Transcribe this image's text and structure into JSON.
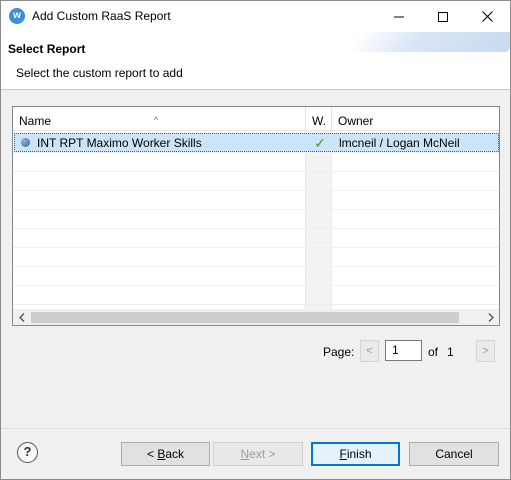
{
  "window": {
    "title": "Add Custom RaaS Report",
    "app_icon_glyph": "w"
  },
  "banner": {
    "title": "Select Report",
    "subtitle": "Select the custom report to add"
  },
  "table": {
    "columns": [
      "Name",
      "W.",
      "Owner"
    ],
    "sort_indicator": "^",
    "rows": [
      {
        "name": "INT RPT Maximo Worker Skills",
        "w_checked": true,
        "check_glyph": "✓",
        "owner": "lmcneil / Logan McNeil",
        "selected": true
      }
    ]
  },
  "pager": {
    "label": "Page:",
    "prev": "<",
    "next": ">",
    "current": "1",
    "of": "of",
    "total": "1"
  },
  "buttons": {
    "back_prefix": "< ",
    "back_mnemonic": "B",
    "back_rest": "ack",
    "next_mnemonic": "N",
    "next_rest": "ext >",
    "finish_mnemonic": "F",
    "finish_rest": "inish",
    "cancel": "Cancel",
    "help": "?"
  },
  "colors": {
    "selection": "#cce4f7",
    "default_button_border": "#0078d7",
    "check": "#3c9a1f"
  },
  "icons": {
    "app": "workday-app-icon",
    "minimize": "minimize-icon",
    "maximize": "maximize-icon",
    "close": "close-icon",
    "row": "report-bullet-icon",
    "help": "help-icon"
  }
}
